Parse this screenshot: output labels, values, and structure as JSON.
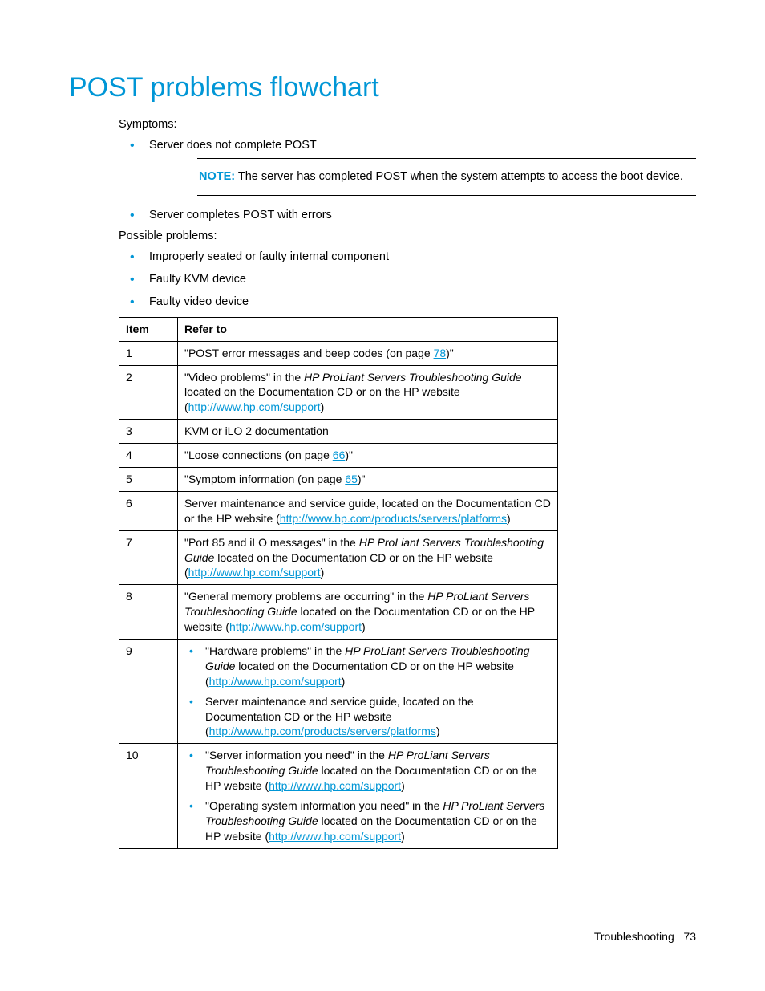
{
  "heading": "POST problems flowchart",
  "symptoms_label": "Symptoms:",
  "symptoms": {
    "item1": "Server does not complete POST",
    "item2": "Server completes POST with errors"
  },
  "note": {
    "label": "NOTE:",
    "text": "  The server has completed POST when the system attempts to access the boot device."
  },
  "problems_label": "Possible problems:",
  "problems": {
    "item1": "Improperly seated or faulty internal component",
    "item2": "Faulty KVM device",
    "item3": "Faulty video device"
  },
  "table": {
    "head_item": "Item",
    "head_refer": "Refer to",
    "row1": {
      "item": "1",
      "t1": "\"POST error messages and beep codes (on page ",
      "link1": "78",
      "t2": ")\""
    },
    "row2": {
      "item": "2",
      "t1": "\"Video problems\" in the ",
      "em1": "HP ProLiant Servers Troubleshooting Guide",
      "t2": " located on the Documentation CD or on the HP website (",
      "link1": "http://www.hp.com/support",
      "t3": ")"
    },
    "row3": {
      "item": "3",
      "t1": "KVM or iLO 2 documentation"
    },
    "row4": {
      "item": "4",
      "t1": "\"Loose connections (on page ",
      "link1": "66",
      "t2": ")\""
    },
    "row5": {
      "item": "5",
      "t1": "\"Symptom information (on page ",
      "link1": "65",
      "t2": ")\""
    },
    "row6": {
      "item": "6",
      "t1": "Server maintenance and service guide, located on the Documentation CD or the HP website (",
      "link1": "http://www.hp.com/products/servers/platforms",
      "t2": ")"
    },
    "row7": {
      "item": "7",
      "t1": "\"Port 85 and iLO messages\" in the ",
      "em1": "HP ProLiant Servers Troubleshooting Guide",
      "t2": " located on the Documentation CD or on the HP website (",
      "link1": "http://www.hp.com/support",
      "t3": ")"
    },
    "row8": {
      "item": "8",
      "t1": "\"General memory problems are occurring\" in the ",
      "em1": "HP ProLiant Servers Troubleshooting Guide",
      "t2": " located on the Documentation CD or on the HP website (",
      "link1": "http://www.hp.com/support",
      "t3": ")"
    },
    "row9": {
      "item": "9",
      "b1_t1": "\"Hardware problems\" in the ",
      "b1_em1": "HP ProLiant Servers Troubleshooting Guide",
      "b1_t2": " located on the Documentation CD or on the HP website (",
      "b1_link1": "http://www.hp.com/support",
      "b1_t3": ")",
      "b2_t1": "Server maintenance and service guide, located on the Documentation CD or the HP website (",
      "b2_link1": "http://www.hp.com/products/servers/platforms",
      "b2_t2": ")"
    },
    "row10": {
      "item": "10",
      "b1_t1": "\"Server information you need\" in the ",
      "b1_em1": "HP ProLiant Servers Troubleshooting Guide",
      "b1_t2": " located on the Documentation CD or on the HP website (",
      "b1_link1": "http://www.hp.com/support",
      "b1_t3": ")",
      "b2_t1": "\"Operating system information you need\" in the ",
      "b2_em1": "HP ProLiant Servers Troubleshooting Guide",
      "b2_t2": " located on the Documentation CD or on the HP website (",
      "b2_link1": "http://www.hp.com/support",
      "b2_t3": ")"
    }
  },
  "footer": {
    "section": "Troubleshooting",
    "page": "73"
  }
}
